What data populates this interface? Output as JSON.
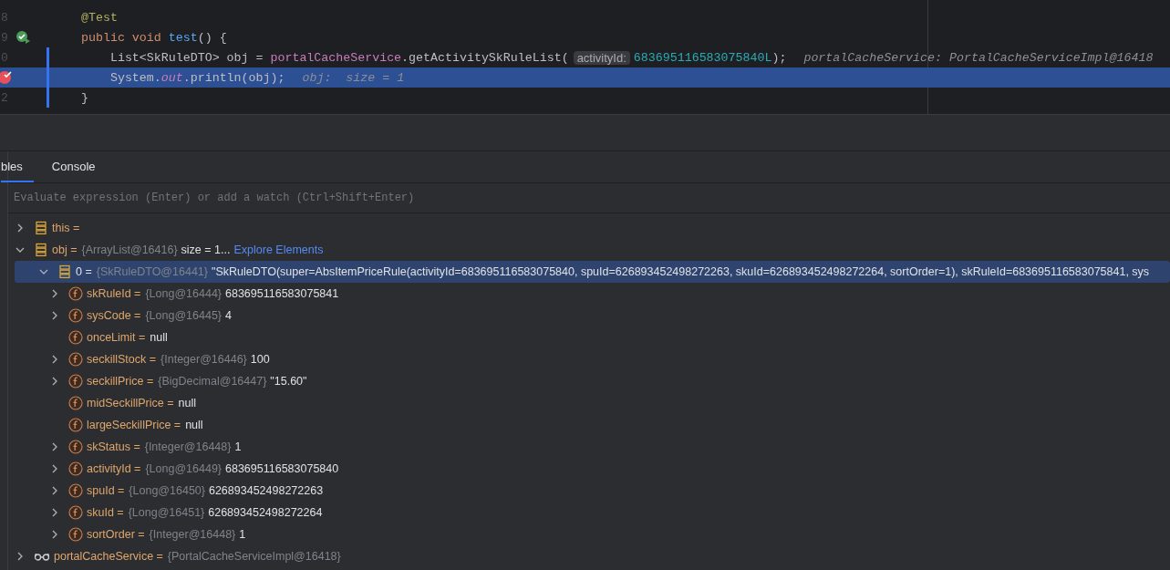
{
  "editor": {
    "lines": [
      {
        "number": "8",
        "run": false,
        "breakpoint": false,
        "current": false,
        "tokens": [
          {
            "kind": "annotation",
            "text": "@Test"
          }
        ]
      },
      {
        "number": "9",
        "run": true,
        "breakpoint": false,
        "current": false,
        "tokens": [
          {
            "kind": "keyword",
            "text": "public void "
          },
          {
            "kind": "decl",
            "text": "test"
          },
          {
            "kind": "plain",
            "text": "() {"
          }
        ]
      },
      {
        "number": "0",
        "run": false,
        "breakpoint": false,
        "current": false,
        "tokens": [
          {
            "kind": "plain",
            "text": "    List<SkRuleDTO> obj = "
          },
          {
            "kind": "field",
            "text": "portalCacheService"
          },
          {
            "kind": "plain",
            "text": ".getActivitySkRuleList("
          },
          {
            "kind": "hint",
            "text": "activityId:"
          },
          {
            "kind": "number",
            "text": "683695116583075840L"
          },
          {
            "kind": "plain",
            "text": ");"
          },
          {
            "kind": "debug",
            "text": "portalCacheService: PortalCacheServiceImpl@16418"
          }
        ]
      },
      {
        "run": false,
        "breakpoint": true,
        "current": true,
        "tokens": [
          {
            "kind": "plain",
            "text": "    System."
          },
          {
            "kind": "static",
            "text": "out"
          },
          {
            "kind": "plain",
            "text": ".println(obj);"
          },
          {
            "kind": "debug",
            "text": "obj:  size = 1"
          }
        ]
      },
      {
        "number": "2",
        "run": false,
        "breakpoint": false,
        "current": false,
        "tokens": [
          {
            "kind": "plain",
            "text": "}"
          }
        ]
      }
    ]
  },
  "debugger": {
    "tabs": [
      {
        "label": "bles",
        "selected": true
      },
      {
        "label": "Console",
        "selected": false
      }
    ],
    "evaluate": {
      "placeholder": "Evaluate expression (Enter) or add a watch (Ctrl+Shift+Enter)"
    },
    "variables": [
      {
        "kind": "local",
        "name": "this =",
        "expandable": true,
        "selected": false
      },
      {
        "kind": "local",
        "name": "obj =",
        "type": "{ArrayList@16416}",
        "value": "size = 1...",
        "link": "Explore Elements",
        "expandable": true,
        "expanded": true,
        "selected": false,
        "children": [
          {
            "kind": "element",
            "name": "0 =",
            "type": "{SkRuleDTO@16441}",
            "value": "\"SkRuleDTO(super=AbsItemPriceRule(activityId=683695116583075840, spuId=626893452498272263, skuId=626893452498272264, sortOrder=1), skRuleId=683695116583075841, sys",
            "expandable": true,
            "expanded": true,
            "selected": true,
            "children": [
              {
                "kind": "field",
                "name": "skRuleId =",
                "type": "{Long@16444}",
                "value": "683695116583075841",
                "expandable": true,
                "selected": false
              },
              {
                "kind": "field",
                "name": "sysCode =",
                "type": "{Long@16445}",
                "value": "4",
                "expandable": true,
                "selected": false
              },
              {
                "kind": "field",
                "name": "onceLimit =",
                "value": "null",
                "expandable": false,
                "selected": false
              },
              {
                "kind": "field",
                "name": "seckillStock =",
                "type": "{Integer@16446}",
                "value": "100",
                "expandable": true,
                "selected": false
              },
              {
                "kind": "field",
                "name": "seckillPrice =",
                "type": "{BigDecimal@16447}",
                "value": "\"15.60\"",
                "expandable": true,
                "selected": false
              },
              {
                "kind": "field",
                "name": "midSeckillPrice =",
                "value": "null",
                "expandable": false,
                "selected": false
              },
              {
                "kind": "field",
                "name": "largeSeckillPrice =",
                "value": "null",
                "expandable": false,
                "selected": false
              },
              {
                "kind": "field",
                "name": "skStatus =",
                "type": "{Integer@16448}",
                "value": "1",
                "expandable": true,
                "selected": false
              },
              {
                "kind": "field",
                "name": "activityId =",
                "type": "{Long@16449}",
                "value": "683695116583075840",
                "expandable": true,
                "selected": false
              },
              {
                "kind": "field",
                "name": "spuId =",
                "type": "{Long@16450}",
                "value": "626893452498272263",
                "expandable": true,
                "selected": false
              },
              {
                "kind": "field",
                "name": "skuId =",
                "type": "{Long@16451}",
                "value": "626893452498272264",
                "expandable": true,
                "selected": false
              },
              {
                "kind": "field",
                "name": "sortOrder =",
                "type": "{Integer@16448}",
                "value": "1",
                "expandable": true,
                "selected": false
              }
            ]
          }
        ]
      },
      {
        "kind": "watch",
        "name": "portalCacheService =",
        "type": "{PortalCacheServiceImpl@16418}",
        "expandable": true,
        "selected": false
      }
    ]
  }
}
